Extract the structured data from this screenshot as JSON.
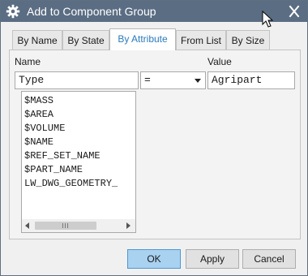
{
  "window": {
    "title": "Add to Component Group"
  },
  "tabs": [
    {
      "label": "By Name"
    },
    {
      "label": "By State"
    },
    {
      "label": "By Attribute",
      "active": true
    },
    {
      "label": "From List"
    },
    {
      "label": "By Size"
    }
  ],
  "form": {
    "name_label": "Name",
    "value_label": "Value",
    "name_value": "Type",
    "operator_value": "=",
    "value_value": "Agripart"
  },
  "attribute_list": [
    "$MASS",
    "$AREA",
    "$VOLUME",
    "$NAME",
    "$REF_SET_NAME",
    "$PART_NAME",
    "LW_DWG_GEOMETRY_"
  ],
  "buttons": {
    "ok": "OK",
    "apply": "Apply",
    "cancel": "Cancel"
  },
  "colors": {
    "titlebar": "#5b6d83",
    "active_tab_text": "#2a7bbd",
    "ok_button": "#a9d2f1"
  }
}
